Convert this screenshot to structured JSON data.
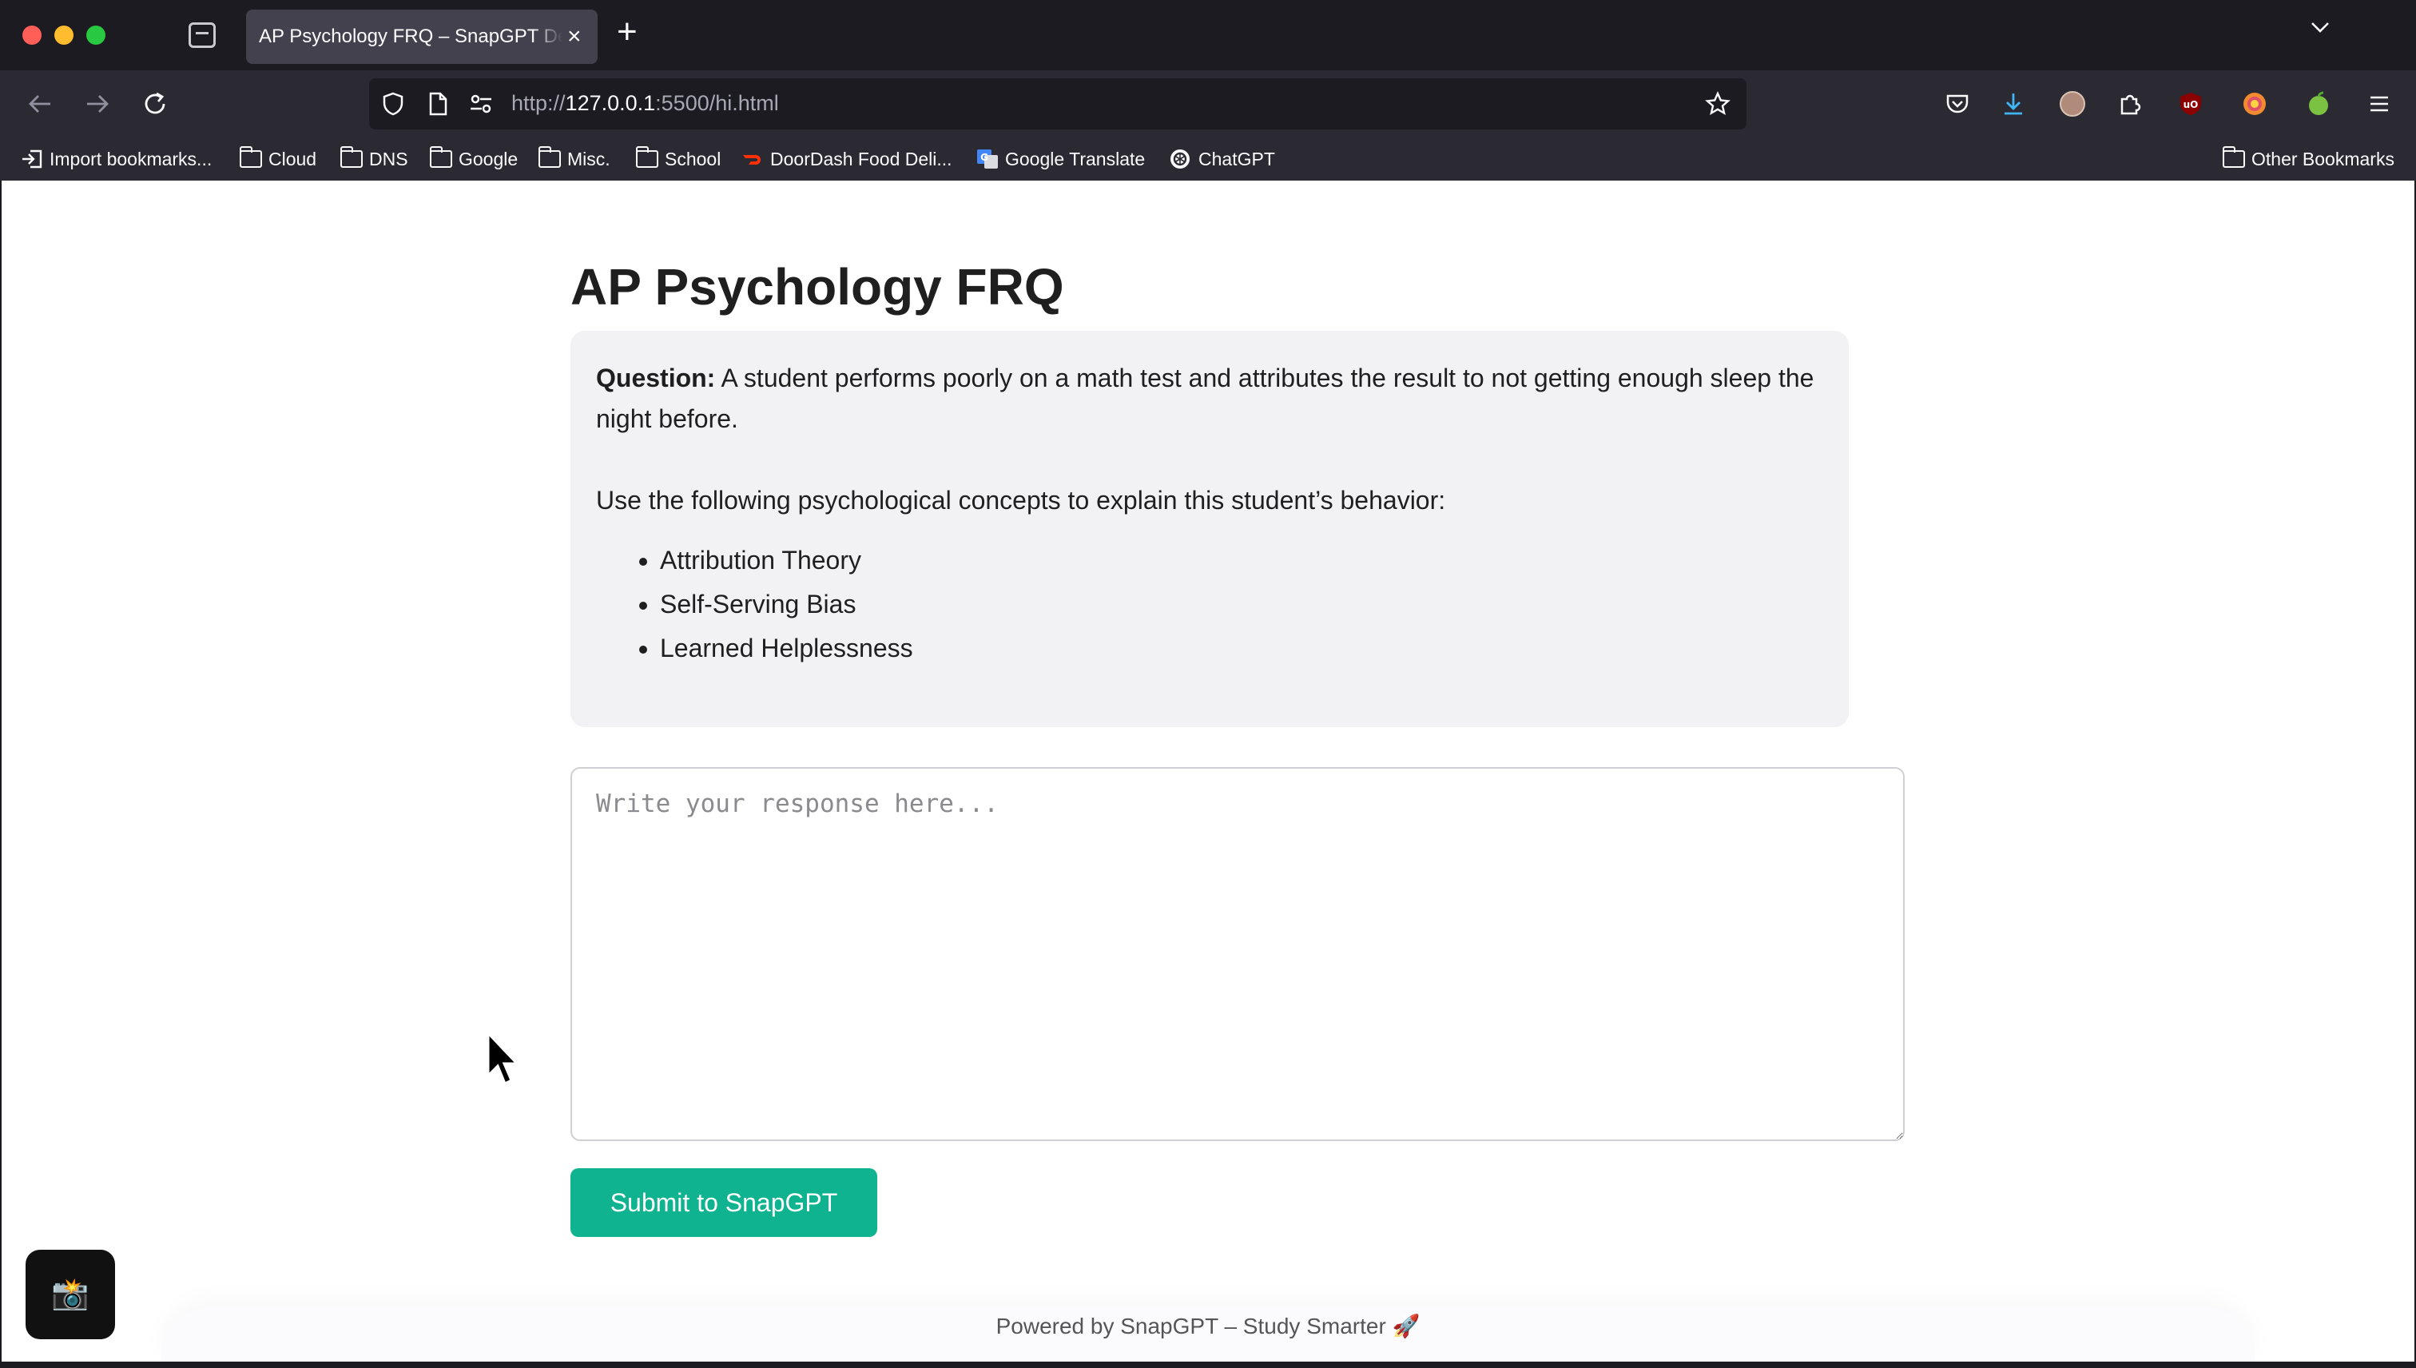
{
  "browser": {
    "tab_title": "AP Psychology FRQ – SnapGPT Demo",
    "tab_close": "×",
    "new_tab": "+",
    "url_prefix": "http://",
    "url_host": "127.0.0.1",
    "url_path": ":5500/hi.html",
    "accent_color": "#10b38f"
  },
  "bookmarks": {
    "items": [
      {
        "label": "Import bookmarks...",
        "icon": "import-icon"
      },
      {
        "label": "Cloud",
        "icon": "folder-icon"
      },
      {
        "label": "DNS",
        "icon": "folder-icon"
      },
      {
        "label": "Google",
        "icon": "folder-icon"
      },
      {
        "label": "Misc.",
        "icon": "folder-icon"
      },
      {
        "label": "School",
        "icon": "folder-icon"
      },
      {
        "label": "DoorDash Food Deli...",
        "icon": "doordash-icon"
      },
      {
        "label": "Google Translate",
        "icon": "google-translate-icon"
      },
      {
        "label": "ChatGPT",
        "icon": "chatgpt-icon"
      }
    ],
    "other": "Other Bookmarks"
  },
  "page": {
    "title": "AP Psychology FRQ",
    "question_label": "Question:",
    "question_text": " A student performs poorly on a math test and attributes the result to not getting enough sleep the night before.",
    "instruction": "Use the following psychological concepts to explain this student’s behavior:",
    "concepts": [
      "Attribution Theory",
      "Self-Serving Bias",
      "Learned Helplessness"
    ],
    "response_placeholder": "Write your response here...",
    "submit_label": "Submit to SnapGPT",
    "footer": "Powered by SnapGPT – Study Smarter 🚀",
    "camera_glyph": "📸"
  }
}
